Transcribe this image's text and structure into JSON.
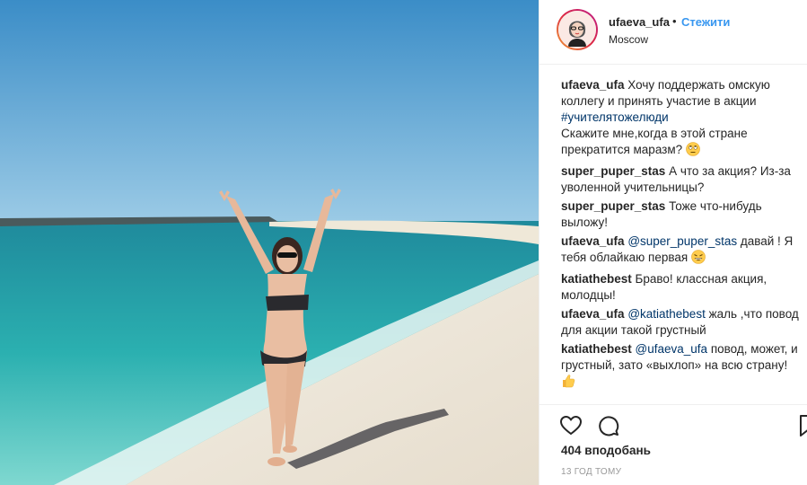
{
  "post": {
    "username": "ufaeva_ufa",
    "separator": "•",
    "follow_label": "Стежити",
    "location": "Moscow"
  },
  "comments": [
    {
      "user": "ufaeva_ufa",
      "text": " Хочу поддержать омскую коллегу и принять участие в акции ",
      "hashtag": "#учителятожелюди",
      "text2": "Скажите мне,когда в этой стране прекратится маразм? ",
      "emoji": "rolling-eyes-emoji"
    },
    {
      "user": "super_puper_stas",
      "text": " А что за акция? Из-за уволенной учительницы?"
    },
    {
      "user": "super_puper_stas",
      "text": " Тоже что-нибудь выложу!"
    },
    {
      "user": "ufaeva_ufa",
      "mention": "@super_puper_stas",
      "text": " давай ! Я тебя облайкаю первая ",
      "emoji": "grinning-emoji"
    },
    {
      "user": "katiathebest",
      "text": " Браво! классная акция, молодцы!"
    },
    {
      "user": "ufaeva_ufa",
      "mention": "@katiathebest",
      "text": " жаль ,что повод для акции такой грустный"
    },
    {
      "user": "katiathebest",
      "mention": "@ufaeva_ufa",
      "text": " повод, может, и грустный, зато «выхлоп» на всю страну! ",
      "emoji": "thumbs-up-emoji"
    }
  ],
  "actions": {
    "like_icon": "heart-icon",
    "comment_icon": "comment-icon",
    "save_icon": "bookmark-icon",
    "likes_text": "404 вподобань",
    "time_text": "13 ГОД ТОМУ"
  },
  "colors": {
    "link": "#3897f0",
    "mention": "#003569",
    "text": "#262626",
    "muted": "#999999"
  }
}
